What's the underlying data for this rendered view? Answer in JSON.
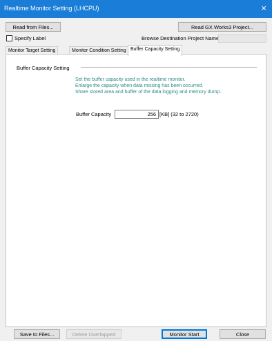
{
  "window": {
    "title": "Realtime Monitor Setting (LHCPU)",
    "close_glyph": "×"
  },
  "toolbar": {
    "read_from_files": "Read from Files...",
    "read_gx_works3": "Read GX Works3 Project...",
    "specify_label": "Specify Label",
    "specify_label_checked": false,
    "browse_destination_label": "Browse Destination Project Name",
    "browse_destination_value": ""
  },
  "tabs": [
    {
      "label": "Monitor Target Setting",
      "active": false
    },
    {
      "label": "Monitor Condition Setting",
      "active": false
    },
    {
      "label": "Buffer Capacity Setting",
      "active": true
    }
  ],
  "buffer": {
    "group_title": "Buffer Capacity Setting",
    "description": [
      "Set the buffer capacity used in the realtime monitor.",
      "Enlarge the capacity when data missing has been occurred.",
      "Share stored area and buffer of the data logging and memory dump."
    ],
    "capacity_label": "Buffer Capacity",
    "capacity_value": "256",
    "capacity_unit_range": "[KB] (32  to  2720)"
  },
  "footer": {
    "save_to_files": "Save to Files...",
    "delete_overlapped": "Delete Overlapped",
    "monitor_start": "Monitor Start",
    "close": "Close"
  },
  "colors": {
    "titlebar": "#1a7dd7",
    "description_text": "#2e8b82",
    "window_bg": "#f0f0f0"
  }
}
